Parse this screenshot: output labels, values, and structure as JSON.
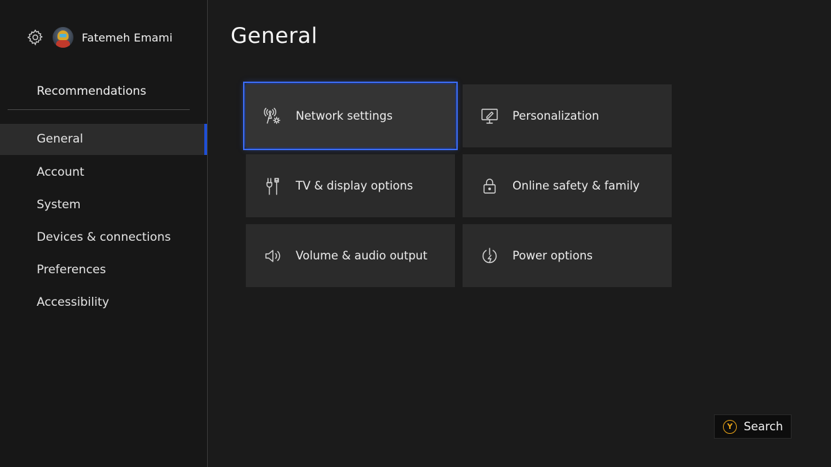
{
  "profile": {
    "username": "Fatemeh Emami",
    "settings_icon": "gear-icon",
    "avatar_icon": "avatar-icon"
  },
  "sidebar": {
    "recommendations": "Recommendations",
    "items": [
      {
        "label": "General",
        "active": true
      },
      {
        "label": "Account",
        "active": false
      },
      {
        "label": "System",
        "active": false
      },
      {
        "label": "Devices & connections",
        "active": false
      },
      {
        "label": "Preferences",
        "active": false
      },
      {
        "label": "Accessibility",
        "active": false
      }
    ]
  },
  "main": {
    "title": "General",
    "tiles": [
      {
        "label": "Network settings",
        "icon": "network-settings-icon",
        "focused": true
      },
      {
        "label": "Personalization",
        "icon": "personalization-icon",
        "focused": false
      },
      {
        "label": "TV & display options",
        "icon": "tv-display-icon",
        "focused": false
      },
      {
        "label": "Online safety & family",
        "icon": "lock-icon",
        "focused": false
      },
      {
        "label": "Volume & audio output",
        "icon": "speaker-icon",
        "focused": false
      },
      {
        "label": "Power options",
        "icon": "power-icon",
        "focused": false
      }
    ]
  },
  "search_hint": {
    "button": "Y",
    "label": "Search"
  },
  "colors": {
    "accent": "#3b6cf5",
    "y_button": "#e8a317",
    "background": "#1b1b1b",
    "tile": "#2b2b2b"
  }
}
